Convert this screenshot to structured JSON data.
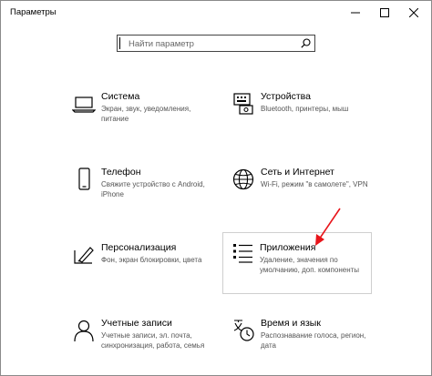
{
  "window": {
    "title": "Параметры"
  },
  "search": {
    "placeholder": "Найти параметр"
  },
  "tiles": [
    {
      "title": "Система",
      "desc": "Экран, звук, уведомления, питание",
      "icon": "laptop-icon"
    },
    {
      "title": "Устройства",
      "desc": "Bluetooth, принтеры, мыш",
      "icon": "keyboard-printer-icon"
    },
    {
      "title": "Телефон",
      "desc": "Свяжите устройство с Android, iPhone",
      "icon": "phone-icon"
    },
    {
      "title": "Сеть и Интернет",
      "desc": "Wi-Fi, режим \"в самолете\", VPN",
      "icon": "globe-icon"
    },
    {
      "title": "Персонализация",
      "desc": "Фон, экран блокировки, цвета",
      "icon": "pen-screen-icon"
    },
    {
      "title": "Приложения",
      "desc": "Удаление, значения по умолчанию, доп. компоненты",
      "icon": "apps-list-icon"
    },
    {
      "title": "Учетные записи",
      "desc": "Учетные записи, эл. почта, синхронизация, работа, семья",
      "icon": "person-icon"
    },
    {
      "title": "Время и язык",
      "desc": "Распознавание голоса, регион, дата",
      "icon": "clock-language-icon"
    }
  ],
  "annotation": {
    "arrow_color": "#e8141a"
  }
}
